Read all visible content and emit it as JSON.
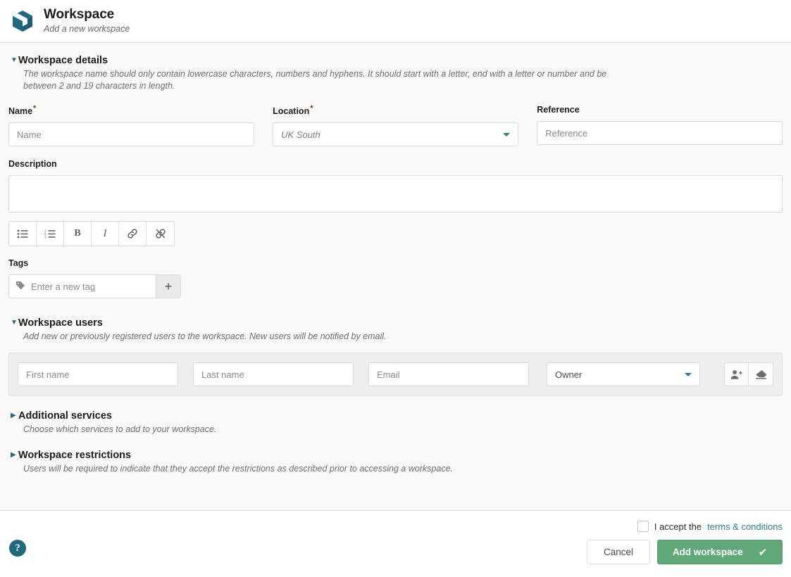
{
  "header": {
    "icon": "cube-icon",
    "title": "Workspace",
    "subtitle": "Add a new workspace"
  },
  "details_section": {
    "twisty": "▼",
    "title": "Workspace details",
    "description": "The workspace name should only contain lowercase characters, numbers and hyphens. It should start with a letter, end with a letter or number and be between 2 and 19 characters in length.",
    "fields": {
      "name": {
        "label": "Name",
        "required": "*",
        "placeholder": "Name",
        "value": ""
      },
      "location": {
        "label": "Location",
        "required": "*",
        "value": "UK South"
      },
      "reference": {
        "label": "Reference",
        "placeholder": "Reference",
        "value": ""
      },
      "description": {
        "label": "Description",
        "value": ""
      },
      "tags": {
        "label": "Tags",
        "placeholder": "Enter a new tag",
        "add_label": "+"
      }
    },
    "rte_toolbar": [
      {
        "name": "bullet-list-icon",
        "label": "Bulleted list"
      },
      {
        "name": "numbered-list-icon",
        "label": "Numbered list"
      },
      {
        "name": "bold-icon",
        "label": "B"
      },
      {
        "name": "italic-icon",
        "label": "I"
      },
      {
        "name": "link-icon",
        "label": "Insert link"
      },
      {
        "name": "unlink-icon",
        "label": "Remove link"
      }
    ]
  },
  "users_section": {
    "twisty": "▼",
    "title": "Workspace users",
    "description": "Add new or previously registered users to the workspace. New users will be notified by email.",
    "row": {
      "first_name_placeholder": "First name",
      "last_name_placeholder": "Last name",
      "email_placeholder": "Email",
      "role_value": "Owner",
      "add_user_label": "Add user",
      "clear_label": "Clear"
    }
  },
  "services_section": {
    "twisty": "▶",
    "title": "Additional services",
    "description": "Choose which services to add to your workspace."
  },
  "restrictions_section": {
    "twisty": "▶",
    "title": "Workspace restrictions",
    "description": "Users will be required to indicate that they accept the restrictions as described prior to accessing a workspace."
  },
  "footer": {
    "help_label": "?",
    "accept_text": "I accept the",
    "terms_link": "terms & conditions",
    "cancel_label": "Cancel",
    "submit_label": "Add workspace",
    "submit_check": "✔"
  },
  "colors": {
    "brand_teal": "#1f6a80",
    "accent_teal": "#2a7f94",
    "primary_green": "#5fa877",
    "required_red": "#8b2f23",
    "panel_gray": "#eeeeee",
    "page_bg": "#f9f9f8"
  }
}
